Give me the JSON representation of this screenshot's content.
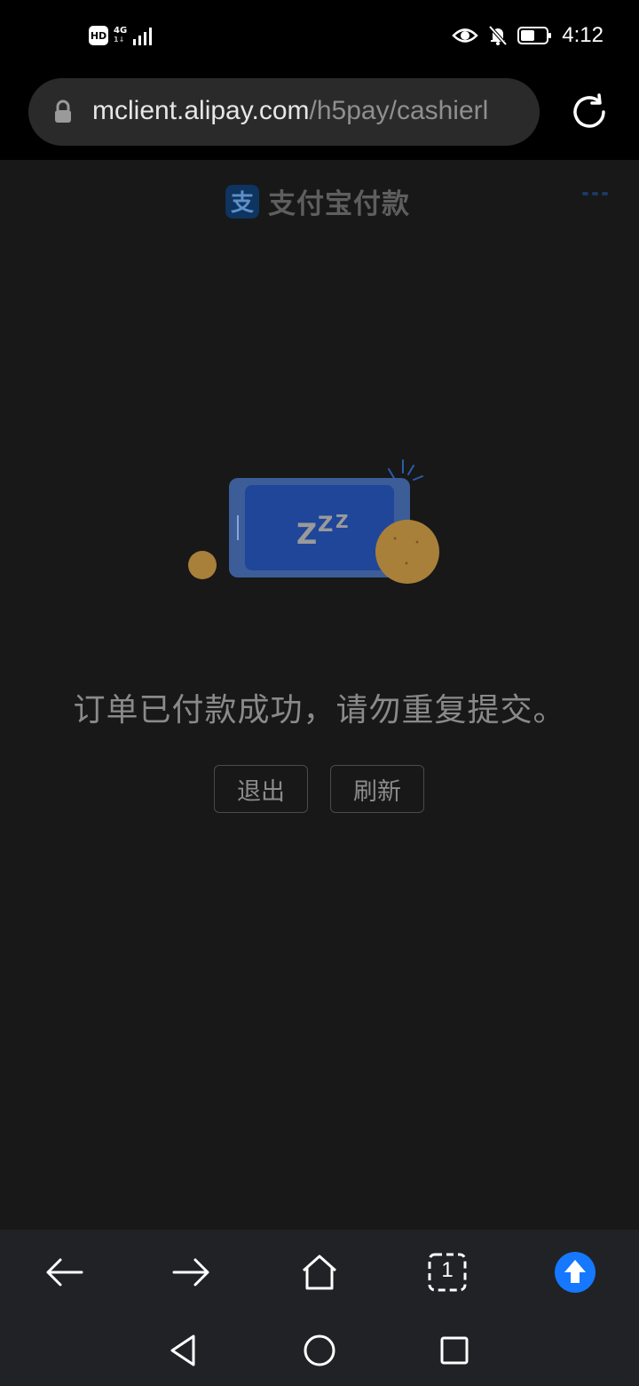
{
  "status_bar": {
    "hd": "HD",
    "network": "4G",
    "network_sub": "1↓",
    "time": "4:12",
    "icons": [
      "signal-icon",
      "eye-icon",
      "bell-muted-icon",
      "battery-icon"
    ]
  },
  "browser": {
    "url_host": "mclient.alipay.com",
    "url_path": "/h5pay/cashierl",
    "icons": [
      "lock-icon",
      "reload-icon"
    ]
  },
  "page": {
    "brand_logo": "支",
    "brand_title": "支付宝付款",
    "illustration_text": "ZZZ",
    "message": "订单已付款成功，请勿重复提交。",
    "buttons": {
      "exit": "退出",
      "refresh": "刷新"
    }
  },
  "toolbar": {
    "tab_count": "1",
    "items": [
      "back-icon",
      "forward-icon",
      "home-icon",
      "tabs-icon",
      "upgrade-icon"
    ]
  },
  "system_nav": [
    "nav-back-icon",
    "nav-home-icon",
    "nav-recents-icon"
  ],
  "colors": {
    "accent": "#1677ff",
    "background": "#181818",
    "coin": "#a8803a"
  }
}
